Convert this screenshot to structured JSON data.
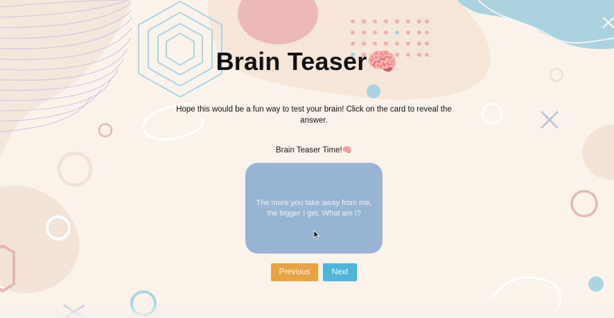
{
  "header": {
    "title": "Brain Teaser🧠",
    "subtitle": "Hope this would be a fun way to test your brain! Click on the card to reveal the answer."
  },
  "quiz": {
    "section_label": "Brain Teaser Time!🧠",
    "card_text": "The more you take away from me, the bigger I get. What am I?"
  },
  "controls": {
    "previous_label": "Previous",
    "next_label": "Next"
  },
  "colors": {
    "background": "#fbf3ea",
    "card": "#98b4d5",
    "previous_button": "#eaa341",
    "next_button": "#4db4dc",
    "accent_blue": "#a9d3e0",
    "accent_pink": "#e6b6b6"
  }
}
